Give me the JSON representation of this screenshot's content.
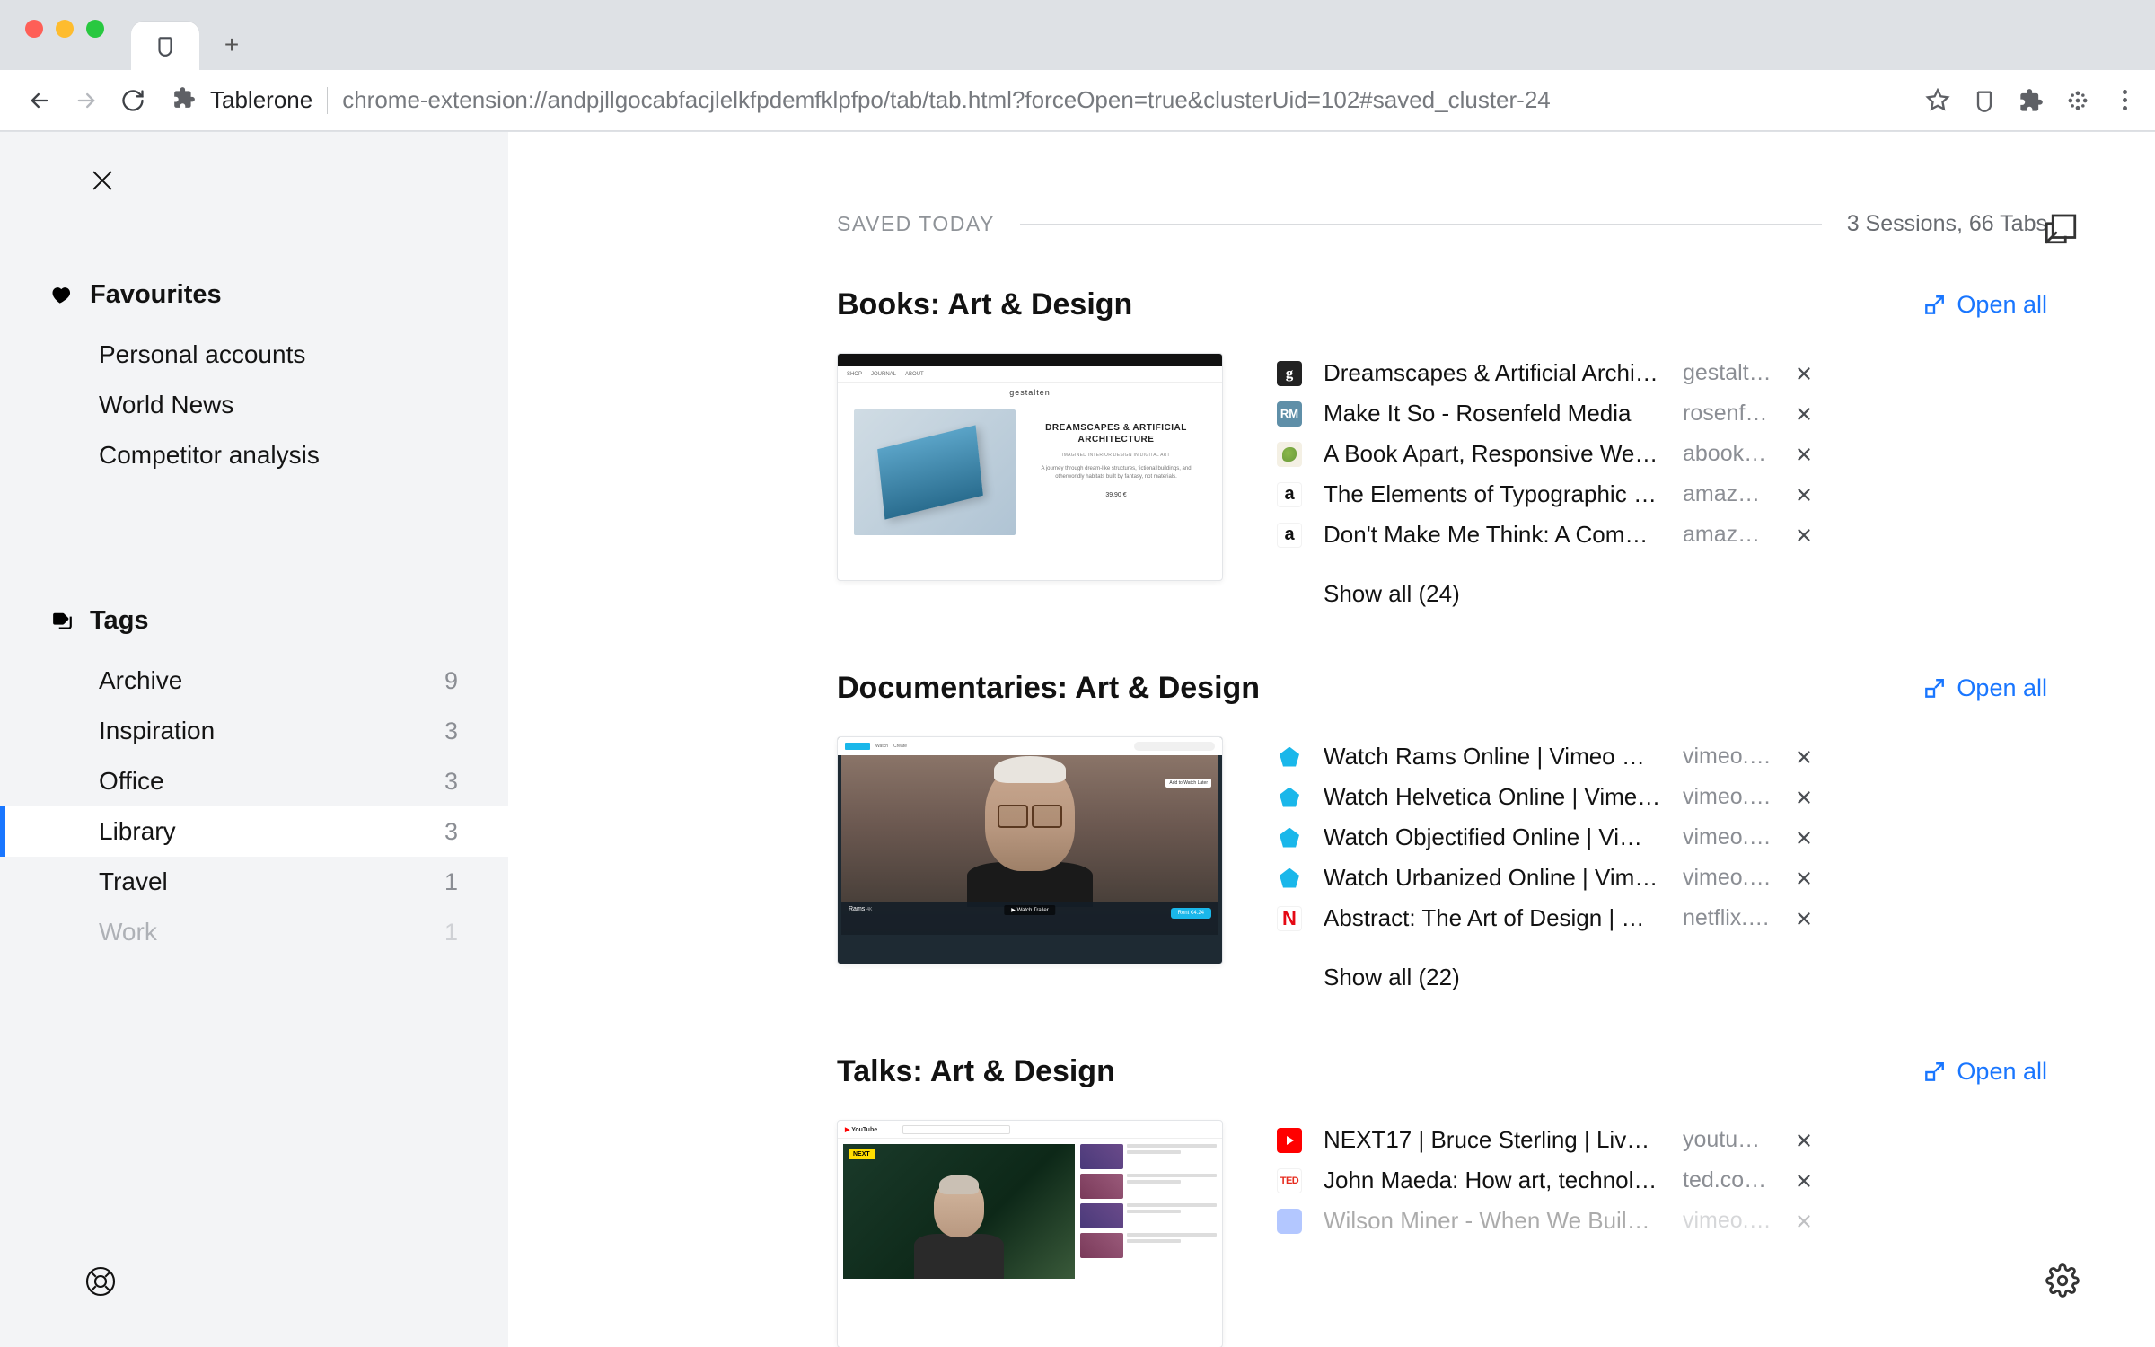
{
  "browser": {
    "page_title": "Tablerone",
    "url": "chrome-extension://andpjllgocabfacjlelkfpdemfklpfpo/tab/tab.html?forceOpen=true&clusterUid=102#saved_cluster-24"
  },
  "sidebar": {
    "favourites": {
      "heading": "Favourites",
      "items": [
        {
          "label": "Personal accounts"
        },
        {
          "label": "World News"
        },
        {
          "label": "Competitor analysis"
        }
      ]
    },
    "tags": {
      "heading": "Tags",
      "items": [
        {
          "label": "Archive",
          "count": "9"
        },
        {
          "label": "Inspiration",
          "count": "3"
        },
        {
          "label": "Office",
          "count": "3"
        },
        {
          "label": "Library",
          "count": "3",
          "active": true
        },
        {
          "label": "Travel",
          "count": "1"
        },
        {
          "label": "Work",
          "count": "1",
          "faded": true
        }
      ]
    }
  },
  "main": {
    "meta": {
      "label": "SAVED TODAY",
      "stats": "3 Sessions, 66 Tabs"
    },
    "open_all_label": "Open all",
    "sessions": [
      {
        "title": "Books: Art & Design",
        "thumb_heading": "DREAMSCAPES & ARTIFICIAL ARCHITECTURE",
        "thumb_sub": "IMAGINED INTERIOR DESIGN IN DIGITAL ART",
        "thumb_logo": "gestalten",
        "thumb_price": "39.90 €",
        "tabs": [
          {
            "title": "Dreamscapes & Artificial Archite…",
            "domain": "gestalte…",
            "favicon": "g"
          },
          {
            "title": "Make It So - Rosenfeld Media",
            "domain": "rosenfel…",
            "favicon": "rm"
          },
          {
            "title": "A Book Apart, Responsive Web D…",
            "domain": "abookap…",
            "favicon": "ab"
          },
          {
            "title": "The Elements of Typographic Sty…",
            "domain": "amazon.…",
            "favicon": "am"
          },
          {
            "title": "Don't Make Me Think: A Common…",
            "domain": "amazon.…",
            "favicon": "am"
          }
        ],
        "show_all": "Show all (24)"
      },
      {
        "title": "Documentaries: Art & Design",
        "thumb_tag": "Rams",
        "thumb_btn": "Rent €4.24",
        "thumb_play": "▶ Watch Trailer",
        "thumb_badge": "Add to Watch Later",
        "tabs": [
          {
            "title": "Watch Rams Online | Vimeo On D…",
            "domain": "vimeo.c…",
            "favicon": "vm"
          },
          {
            "title": "Watch Helvetica Online | Vimeo …",
            "domain": "vimeo.c…",
            "favicon": "vm"
          },
          {
            "title": "Watch Objectified Online | Vimeo…",
            "domain": "vimeo.c…",
            "favicon": "vm"
          },
          {
            "title": "Watch Urbanized Online | Vimeo …",
            "domain": "vimeo.c…",
            "favicon": "vm"
          },
          {
            "title": "Abstract: The Art of Design | Net…",
            "domain": "netflix.c…",
            "favicon": "nf"
          }
        ],
        "show_all": "Show all (22)"
      },
      {
        "title": "Talks: Art & Design",
        "thumb_tag": "NEXT",
        "tabs": [
          {
            "title": "NEXT17 | Bruce Sterling | Live fro…",
            "domain": "youtube.…",
            "favicon": "yt"
          },
          {
            "title": "John Maeda: How art, technolog…",
            "domain": "ted.com/…",
            "favicon": "ted"
          },
          {
            "title": "Wilson Miner - When We Build a…",
            "domain": "vimeo.c…",
            "favicon": "vm2"
          }
        ]
      }
    ]
  }
}
